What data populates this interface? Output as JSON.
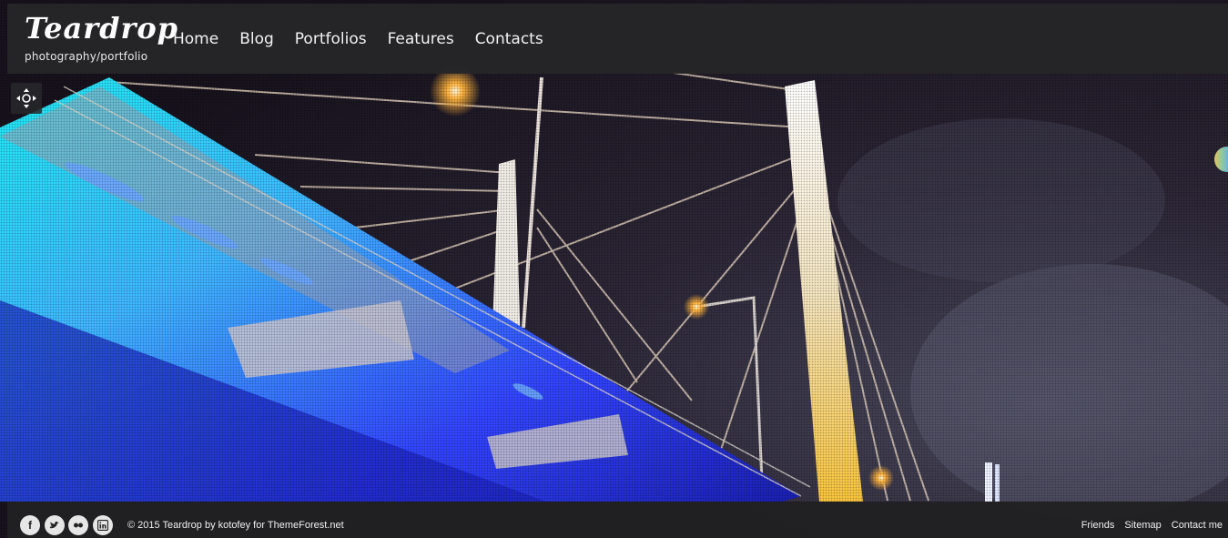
{
  "brand": {
    "logo_text": "Teardrop",
    "tagline": "photography/portfolio"
  },
  "nav": {
    "items": [
      "Home",
      "Blog",
      "Portfolios",
      "Features",
      "Contacts"
    ]
  },
  "hero": {
    "control_icon": "move-arrows-icon",
    "colors": {
      "sky": "#1e1a26",
      "bridge_blue": "#2f3dff",
      "bridge_cyan": "#1fe4ee",
      "pylon_gold": "#f2c54a",
      "lamp": "#ffb23c"
    }
  },
  "footer": {
    "social_icons": [
      "facebook-icon",
      "twitter-icon",
      "flickr-icon",
      "linkedin-icon"
    ],
    "copyright_prefix": "© 2015 Teardrop by ",
    "author": "kotofey",
    "copyright_middle": " for ",
    "site": "ThemeForest.net",
    "links": [
      "Friends",
      "Sitemap",
      "Contact me"
    ]
  }
}
